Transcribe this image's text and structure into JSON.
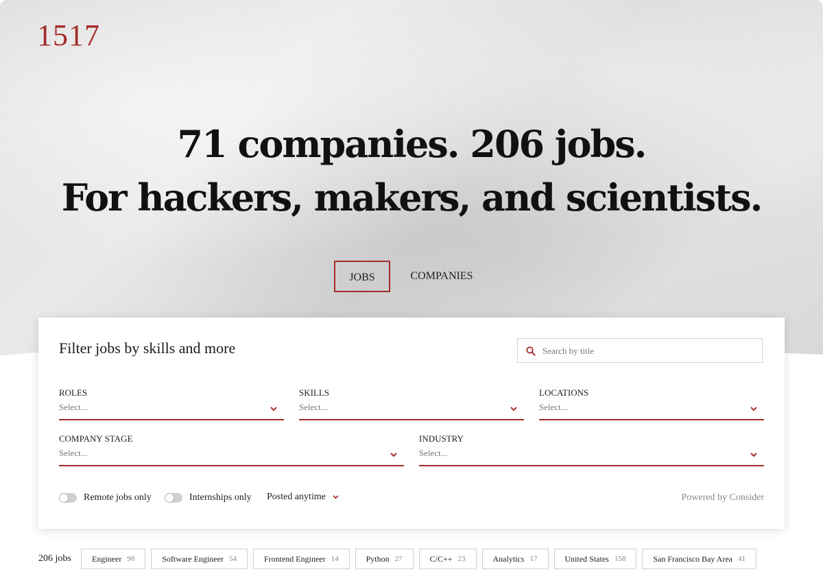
{
  "brand": {
    "logo": "1517"
  },
  "hero": {
    "line1": "71 companies. 206 jobs.",
    "line2": "For hackers, makers, and scientists."
  },
  "tabs": [
    {
      "label": "JOBS",
      "active": true
    },
    {
      "label": "COMPANIES",
      "active": false
    }
  ],
  "filter": {
    "title": "Filter jobs by skills and more",
    "search_placeholder": "Search by title",
    "fields": {
      "roles": {
        "label": "ROLES",
        "placeholder": "Select..."
      },
      "skills": {
        "label": "SKILLS",
        "placeholder": "Select..."
      },
      "locations": {
        "label": "LOCATIONS",
        "placeholder": "Select..."
      },
      "company_stage": {
        "label": "COMPANY STAGE",
        "placeholder": "Select..."
      },
      "industry": {
        "label": "INDUSTRY",
        "placeholder": "Select..."
      }
    },
    "remote_label": "Remote jobs only",
    "remote_on": false,
    "internships_label": "Internships only",
    "internships_on": false,
    "posted_label": "Posted anytime",
    "powered_by": "Powered by Consider"
  },
  "results": {
    "count_label": "206 jobs",
    "chips": [
      {
        "label": "Engineer",
        "count": "98"
      },
      {
        "label": "Software Engineer",
        "count": "54"
      },
      {
        "label": "Frontend Engineer",
        "count": "14"
      },
      {
        "label": "Python",
        "count": "27"
      },
      {
        "label": "C/C++",
        "count": "23"
      },
      {
        "label": "Analytics",
        "count": "17"
      },
      {
        "label": "United States",
        "count": "158"
      },
      {
        "label": "San Francisco Bay Area",
        "count": "41"
      }
    ]
  },
  "colors": {
    "accent": "#a52a2a",
    "text": "#1d1d1d",
    "muted": "#888888"
  }
}
